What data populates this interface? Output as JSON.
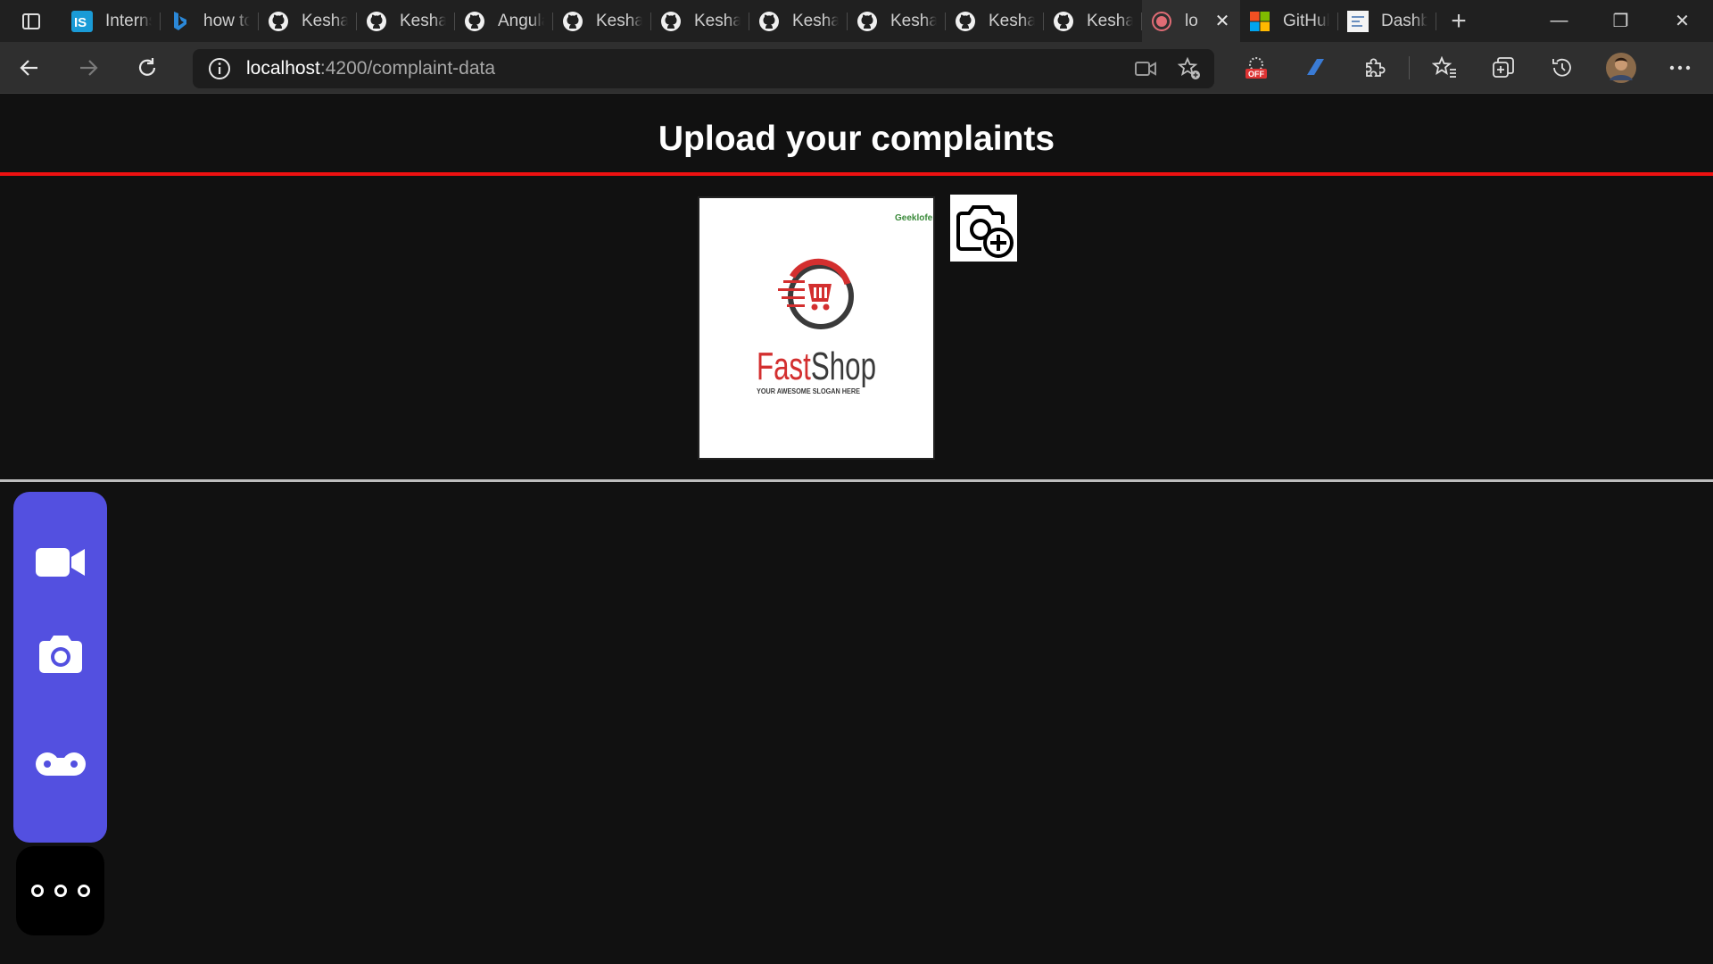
{
  "browser": {
    "tabs": [
      {
        "label": "Interns",
        "icon": "internshala-icon"
      },
      {
        "label": "how to",
        "icon": "bing-icon"
      },
      {
        "label": "Keshav",
        "icon": "github-icon"
      },
      {
        "label": "Keshav",
        "icon": "github-icon"
      },
      {
        "label": "Angula",
        "icon": "github-icon"
      },
      {
        "label": "Keshav",
        "icon": "github-icon"
      },
      {
        "label": "Keshav",
        "icon": "github-icon"
      },
      {
        "label": "Keshav",
        "icon": "github-icon"
      },
      {
        "label": "Keshav",
        "icon": "github-icon"
      },
      {
        "label": "Keshav",
        "icon": "github-icon"
      },
      {
        "label": "Keshav",
        "icon": "github-icon"
      },
      {
        "label": "lo",
        "icon": "recording-icon",
        "active": true
      },
      {
        "label": "GitHub",
        "icon": "microsoft-icon"
      },
      {
        "label": "Dashb",
        "icon": "dashboard-icon"
      }
    ],
    "address": {
      "host": "localhost",
      "path": ":4200/complaint-data"
    },
    "extension_badge": "OFF"
  },
  "page": {
    "title": "Upload your complaints",
    "uploaded_image": {
      "brand_first": "Fast",
      "brand_second": "Shop",
      "slogan": "YOUR AWESOME SLOGAN HERE",
      "corner_mark": "Geeklofer",
      "colors": {
        "red": "#d32f2f",
        "dark": "#3a3a3a"
      }
    },
    "side_panel": {
      "buttons": [
        "video-camera-icon",
        "camera-icon",
        "voicemail-icon"
      ],
      "more": "more-options-icon"
    },
    "colors": {
      "background": "#111111",
      "accent_red": "#ee1111",
      "panel_purple": "#5350e0"
    }
  }
}
